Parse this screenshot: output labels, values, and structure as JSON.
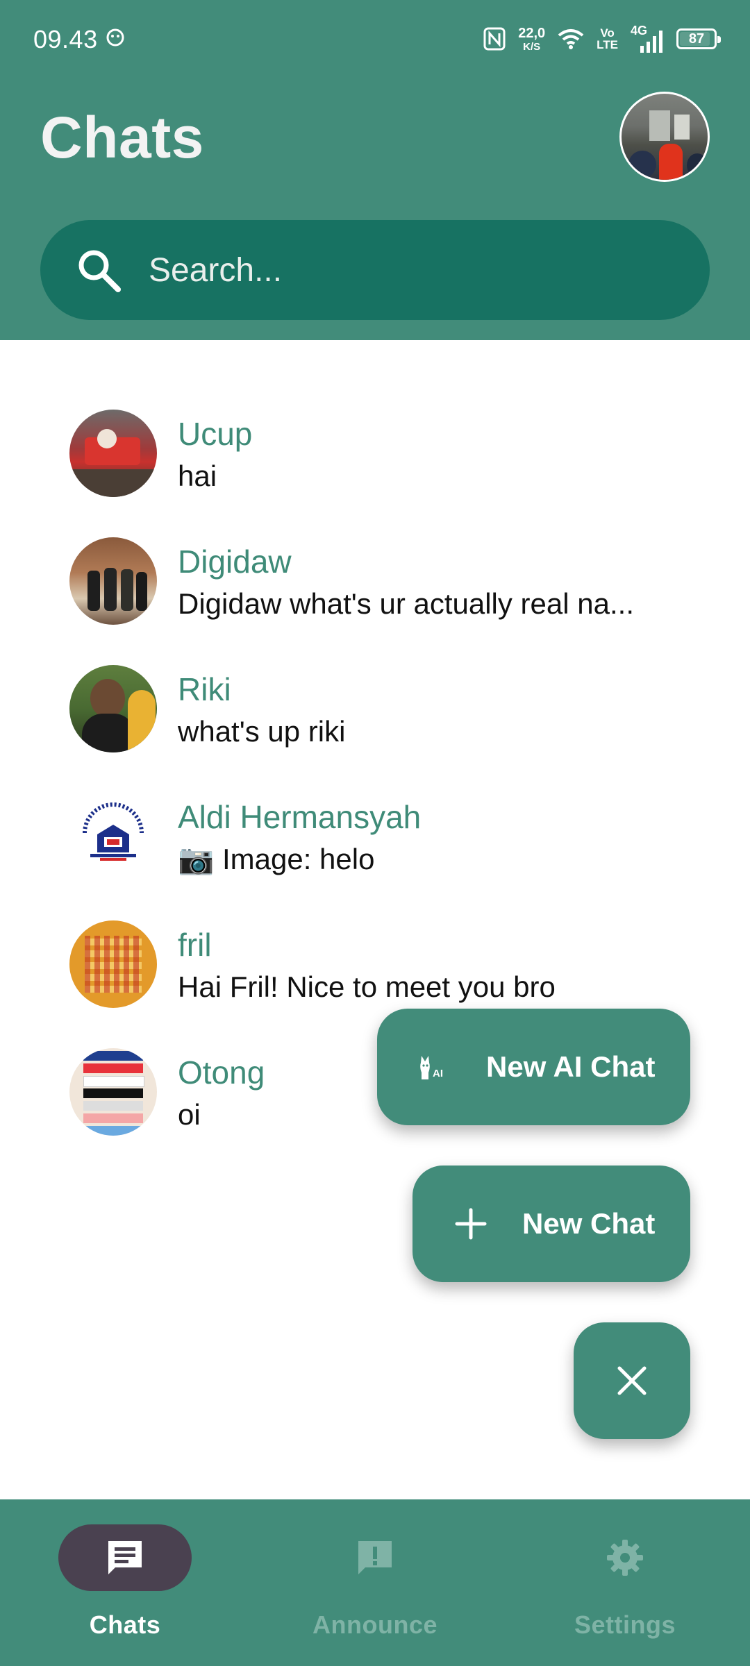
{
  "status_bar": {
    "time": "09.43",
    "speed_value": "22,0",
    "speed_unit": "K/S",
    "volte_top": "Vo",
    "volte_bottom": "LTE",
    "network": "4G",
    "battery": "87"
  },
  "header": {
    "title": "Chats",
    "profile_avatar_icon": "profile-photo"
  },
  "search": {
    "placeholder": "Search..."
  },
  "chats": [
    {
      "name": "Ucup",
      "preview": "hai"
    },
    {
      "name": "Digidaw",
      "preview": "Digidaw what's ur actually real na..."
    },
    {
      "name": "Riki",
      "preview": "what's up riki"
    },
    {
      "name": "Aldi Hermansyah",
      "preview": "📷 Image: helo"
    },
    {
      "name": "fril",
      "preview": "Hai Fril! Nice to meet you bro"
    },
    {
      "name": "Otong",
      "preview": "oi"
    }
  ],
  "fab_menu": {
    "ai_chat_label": "New AI Chat",
    "new_chat_label": "New Chat",
    "ai_icon_text": "AI"
  },
  "bottom_nav": {
    "items": [
      {
        "label": "Chats",
        "icon": "chat-icon",
        "active": true
      },
      {
        "label": "Announce",
        "icon": "announce-icon",
        "active": false
      },
      {
        "label": "Settings",
        "icon": "gear-icon",
        "active": false
      }
    ]
  },
  "colors": {
    "primary": "#428c7a",
    "search_bg": "#177262",
    "active_pill": "#4a4150",
    "name_text": "#3f8b78"
  }
}
